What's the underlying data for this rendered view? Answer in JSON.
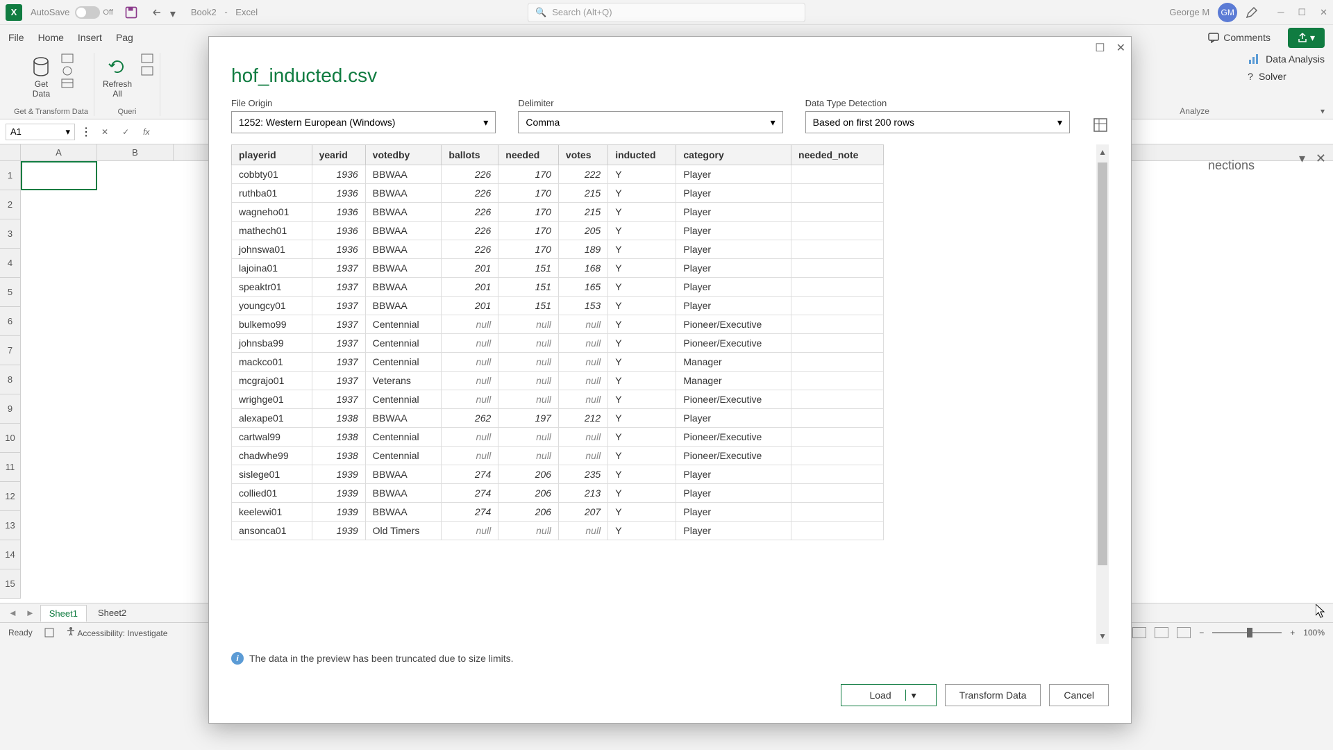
{
  "titlebar": {
    "autosave": "AutoSave",
    "toggle_state": "Off",
    "doc_name": "Book2",
    "app_name": "Excel",
    "search_placeholder": "Search (Alt+Q)",
    "user_name": "George M",
    "user_initials": "GM"
  },
  "ribbon_tabs": [
    "File",
    "Home",
    "Insert",
    "Pag"
  ],
  "ribbon_actions": {
    "comments": "Comments",
    "share": ""
  },
  "ribbon": {
    "get_data": "Get\nData",
    "refresh_all": "Refresh\nAll",
    "group1_label": "Get & Transform Data",
    "group2_label": "Queri",
    "data_analysis": "Data Analysis",
    "solver": "Solver",
    "analyze": "Analyze"
  },
  "formula": {
    "name_box": "A1"
  },
  "columns": [
    "A",
    "B"
  ],
  "row_nums": [
    "1",
    "2",
    "3",
    "4",
    "5",
    "6",
    "7",
    "8",
    "9",
    "10",
    "11",
    "12",
    "13",
    "14",
    "15"
  ],
  "right_pane": {
    "title": "nections"
  },
  "sheets": {
    "nav_prev": "◄",
    "nav_next": "►",
    "active": "Sheet1",
    "other": "Sheet2"
  },
  "statusbar": {
    "ready": "Ready",
    "accessibility": "Accessibility: Investigate",
    "zoom": "100%"
  },
  "dialog": {
    "title": "hof_inducted.csv",
    "file_origin_label": "File Origin",
    "file_origin_value": "1252: Western European (Windows)",
    "delimiter_label": "Delimiter",
    "delimiter_value": "Comma",
    "detection_label": "Data Type Detection",
    "detection_value": "Based on first 200 rows",
    "info_text": "The data in the preview has been truncated due to size limits.",
    "load": "Load",
    "transform": "Transform Data",
    "cancel": "Cancel",
    "columns": [
      "playerid",
      "yearid",
      "votedby",
      "ballots",
      "needed",
      "votes",
      "inducted",
      "category",
      "needed_note"
    ],
    "rows": [
      {
        "playerid": "cobbty01",
        "yearid": "1936",
        "votedby": "BBWAA",
        "ballots": "226",
        "needed": "170",
        "votes": "222",
        "inducted": "Y",
        "category": "Player",
        "needed_note": ""
      },
      {
        "playerid": "ruthba01",
        "yearid": "1936",
        "votedby": "BBWAA",
        "ballots": "226",
        "needed": "170",
        "votes": "215",
        "inducted": "Y",
        "category": "Player",
        "needed_note": ""
      },
      {
        "playerid": "wagneho01",
        "yearid": "1936",
        "votedby": "BBWAA",
        "ballots": "226",
        "needed": "170",
        "votes": "215",
        "inducted": "Y",
        "category": "Player",
        "needed_note": ""
      },
      {
        "playerid": "mathech01",
        "yearid": "1936",
        "votedby": "BBWAA",
        "ballots": "226",
        "needed": "170",
        "votes": "205",
        "inducted": "Y",
        "category": "Player",
        "needed_note": ""
      },
      {
        "playerid": "johnswa01",
        "yearid": "1936",
        "votedby": "BBWAA",
        "ballots": "226",
        "needed": "170",
        "votes": "189",
        "inducted": "Y",
        "category": "Player",
        "needed_note": ""
      },
      {
        "playerid": "lajoina01",
        "yearid": "1937",
        "votedby": "BBWAA",
        "ballots": "201",
        "needed": "151",
        "votes": "168",
        "inducted": "Y",
        "category": "Player",
        "needed_note": ""
      },
      {
        "playerid": "speaktr01",
        "yearid": "1937",
        "votedby": "BBWAA",
        "ballots": "201",
        "needed": "151",
        "votes": "165",
        "inducted": "Y",
        "category": "Player",
        "needed_note": ""
      },
      {
        "playerid": "youngcy01",
        "yearid": "1937",
        "votedby": "BBWAA",
        "ballots": "201",
        "needed": "151",
        "votes": "153",
        "inducted": "Y",
        "category": "Player",
        "needed_note": ""
      },
      {
        "playerid": "bulkemo99",
        "yearid": "1937",
        "votedby": "Centennial",
        "ballots": "null",
        "needed": "null",
        "votes": "null",
        "inducted": "Y",
        "category": "Pioneer/Executive",
        "needed_note": ""
      },
      {
        "playerid": "johnsba99",
        "yearid": "1937",
        "votedby": "Centennial",
        "ballots": "null",
        "needed": "null",
        "votes": "null",
        "inducted": "Y",
        "category": "Pioneer/Executive",
        "needed_note": ""
      },
      {
        "playerid": "mackco01",
        "yearid": "1937",
        "votedby": "Centennial",
        "ballots": "null",
        "needed": "null",
        "votes": "null",
        "inducted": "Y",
        "category": "Manager",
        "needed_note": ""
      },
      {
        "playerid": "mcgrajo01",
        "yearid": "1937",
        "votedby": "Veterans",
        "ballots": "null",
        "needed": "null",
        "votes": "null",
        "inducted": "Y",
        "category": "Manager",
        "needed_note": ""
      },
      {
        "playerid": "wrighge01",
        "yearid": "1937",
        "votedby": "Centennial",
        "ballots": "null",
        "needed": "null",
        "votes": "null",
        "inducted": "Y",
        "category": "Pioneer/Executive",
        "needed_note": ""
      },
      {
        "playerid": "alexape01",
        "yearid": "1938",
        "votedby": "BBWAA",
        "ballots": "262",
        "needed": "197",
        "votes": "212",
        "inducted": "Y",
        "category": "Player",
        "needed_note": ""
      },
      {
        "playerid": "cartwal99",
        "yearid": "1938",
        "votedby": "Centennial",
        "ballots": "null",
        "needed": "null",
        "votes": "null",
        "inducted": "Y",
        "category": "Pioneer/Executive",
        "needed_note": ""
      },
      {
        "playerid": "chadwhe99",
        "yearid": "1938",
        "votedby": "Centennial",
        "ballots": "null",
        "needed": "null",
        "votes": "null",
        "inducted": "Y",
        "category": "Pioneer/Executive",
        "needed_note": ""
      },
      {
        "playerid": "sislege01",
        "yearid": "1939",
        "votedby": "BBWAA",
        "ballots": "274",
        "needed": "206",
        "votes": "235",
        "inducted": "Y",
        "category": "Player",
        "needed_note": ""
      },
      {
        "playerid": "collied01",
        "yearid": "1939",
        "votedby": "BBWAA",
        "ballots": "274",
        "needed": "206",
        "votes": "213",
        "inducted": "Y",
        "category": "Player",
        "needed_note": ""
      },
      {
        "playerid": "keelewi01",
        "yearid": "1939",
        "votedby": "BBWAA",
        "ballots": "274",
        "needed": "206",
        "votes": "207",
        "inducted": "Y",
        "category": "Player",
        "needed_note": ""
      },
      {
        "playerid": "ansonca01",
        "yearid": "1939",
        "votedby": "Old Timers",
        "ballots": "null",
        "needed": "null",
        "votes": "null",
        "inducted": "Y",
        "category": "Player",
        "needed_note": ""
      }
    ]
  }
}
